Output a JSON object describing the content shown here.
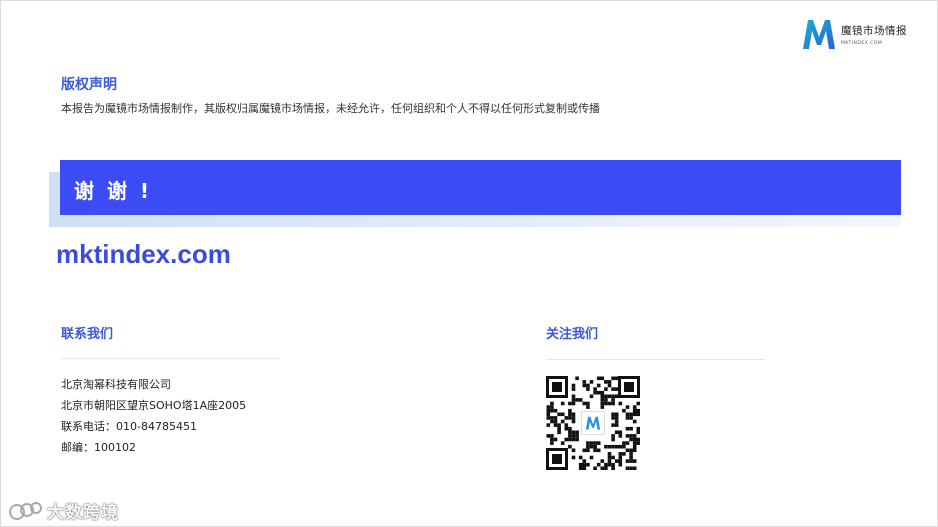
{
  "header": {
    "logo_cn": "魔镜市场情报",
    "logo_en": "MKTINDEX.COM",
    "brand_colors": [
      "#1aa3c8",
      "#2f5be0"
    ]
  },
  "copyright": {
    "title": "版权声明",
    "text": "本报告为魔镜市场情报制作，其版权归属魔镜市场情报，未经允许，任何组织和个人不得以任何形式复制或传播"
  },
  "banner": {
    "text": "谢 谢 !",
    "color": "#3b4cf5"
  },
  "website": "mktindex.com",
  "contact": {
    "title": "联系我们",
    "company": "北京淘幂科技有限公司",
    "address": "北京市朝阳区望京SOHO塔1A座2005",
    "phone": "联系电话：010-84785451",
    "postcode": "邮编：100102"
  },
  "follow": {
    "title": "关注我们",
    "qr_icon": "qr-code"
  },
  "watermark": {
    "text": "大数跨境"
  }
}
